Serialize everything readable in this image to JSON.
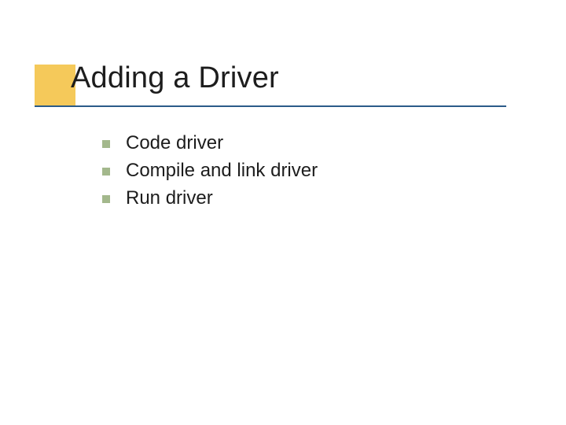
{
  "title": "Adding a Driver",
  "bullets": [
    {
      "text": "Code driver"
    },
    {
      "text": "Compile and link driver"
    },
    {
      "text": "Run driver"
    }
  ]
}
